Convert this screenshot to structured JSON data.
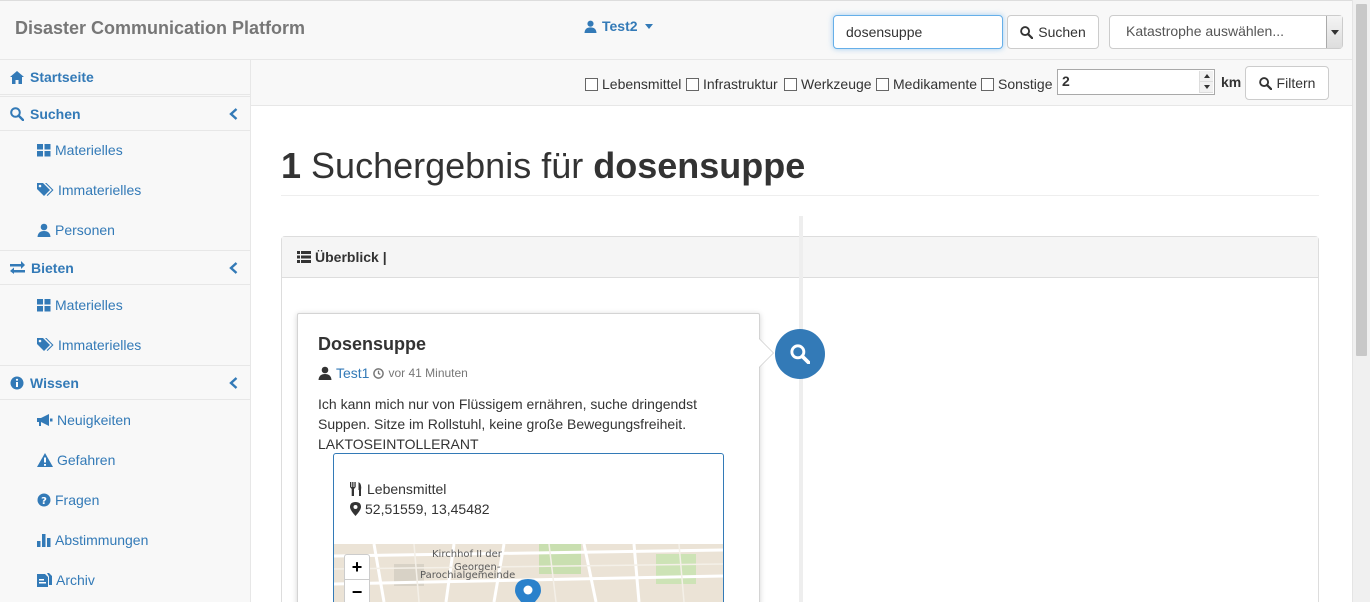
{
  "app": {
    "title": "Disaster Communication Platform"
  },
  "user": {
    "name": "Test2"
  },
  "search": {
    "value": "dosensuppe",
    "button_label": "Suchen"
  },
  "disaster_select": {
    "selected": "Katastrophe auswählen..."
  },
  "sidebar": {
    "home": "Startseite",
    "sections": [
      {
        "label": "Suchen",
        "items": [
          "Materielles",
          "Immaterielles",
          "Personen"
        ]
      },
      {
        "label": "Bieten",
        "items": [
          "Materielles",
          "Immaterielles"
        ]
      },
      {
        "label": "Wissen",
        "items": [
          "Neuigkeiten",
          "Gefahren",
          "Fragen",
          "Abstimmungen",
          "Archiv"
        ]
      }
    ]
  },
  "filters": {
    "categories": [
      "Lebensmittel",
      "Infrastruktur",
      "Werkzeuge",
      "Medikamente",
      "Sonstige"
    ],
    "radius_value": "2",
    "radius_unit": "km",
    "button_label": "Filtern"
  },
  "results": {
    "count": "1",
    "label": "Suchergebnis für",
    "term": "dosensuppe"
  },
  "panel": {
    "title": "Überblick |"
  },
  "card": {
    "title": "Dosensuppe",
    "author": "Test1",
    "time": "vor 41 Minuten",
    "text": "Ich kann mich nur von Flüssigem ernähren, suche dringendst Suppen. Sitze im Rollstuhl, keine große Bewegungsfreiheit. LAKTOSEINTOLLERANT",
    "category": "Lebensmittel",
    "coords": "52,51559, 13,45482",
    "map_label_1": "Kirchhof II der",
    "map_label_2": "Georgen-",
    "map_label_3": "Parochialgemeinde",
    "zoom_in": "+",
    "zoom_out": "−"
  }
}
